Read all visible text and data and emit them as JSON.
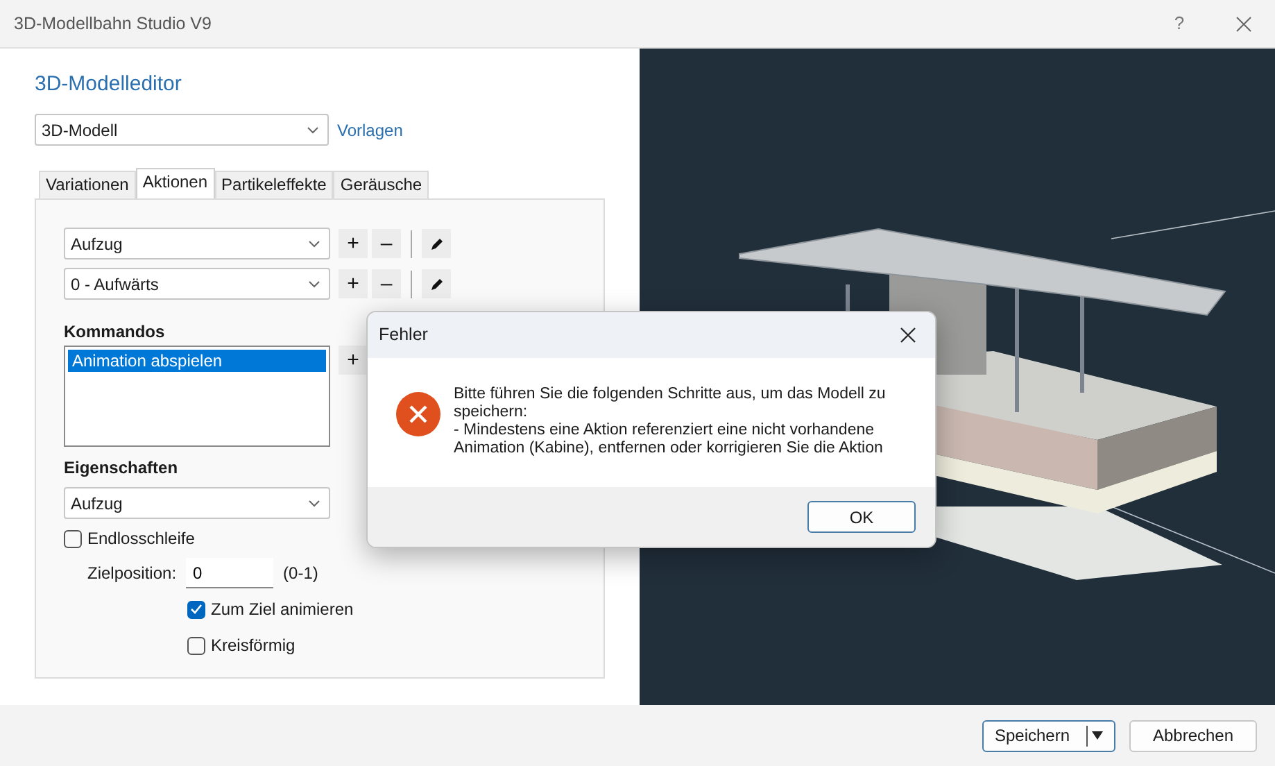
{
  "window": {
    "title": "3D-Modellbahn Studio V9",
    "help": "?"
  },
  "editor": {
    "heading": "3D-Modelleditor",
    "model_select": {
      "value": "3D-Modell"
    },
    "templates_link": "Vorlagen",
    "tabs": [
      {
        "label": "Variationen",
        "selected": false
      },
      {
        "label": "Aktionen",
        "selected": true
      },
      {
        "label": "Partikeleffekte",
        "selected": false
      },
      {
        "label": "Geräusche",
        "selected": false
      }
    ],
    "selector_rows": [
      {
        "value": "Aufzug",
        "add": "+",
        "remove": "–"
      },
      {
        "value": "0 - Aufwärts",
        "add": "+",
        "remove": "–"
      }
    ],
    "commands_label": "Kommandos",
    "commands": [
      {
        "label": "Animation abspielen",
        "selected": true
      }
    ],
    "commands_add": "+",
    "properties_label": "Eigenschaften",
    "property_select": {
      "value": "Aufzug"
    },
    "loop": {
      "label": "Endlosschleife",
      "checked": false
    },
    "target": {
      "label": "Zielposition:",
      "value": "0",
      "range": "(0-1)"
    },
    "options": [
      {
        "label": "Zum Ziel animieren",
        "checked": true
      },
      {
        "label": "Kreisförmig",
        "checked": false
      }
    ]
  },
  "footer": {
    "save": "Speichern",
    "cancel": "Abbrechen"
  },
  "dialog": {
    "title": "Fehler",
    "lines": [
      "Bitte führen Sie die folgenden Schritte aus, um das Modell zu speichern:",
      "- Mindestens eine Aktion referenziert eine nicht vorhandene Animation (Kabine), entfernen oder korrigieren Sie die Aktion"
    ],
    "ok": "OK"
  }
}
